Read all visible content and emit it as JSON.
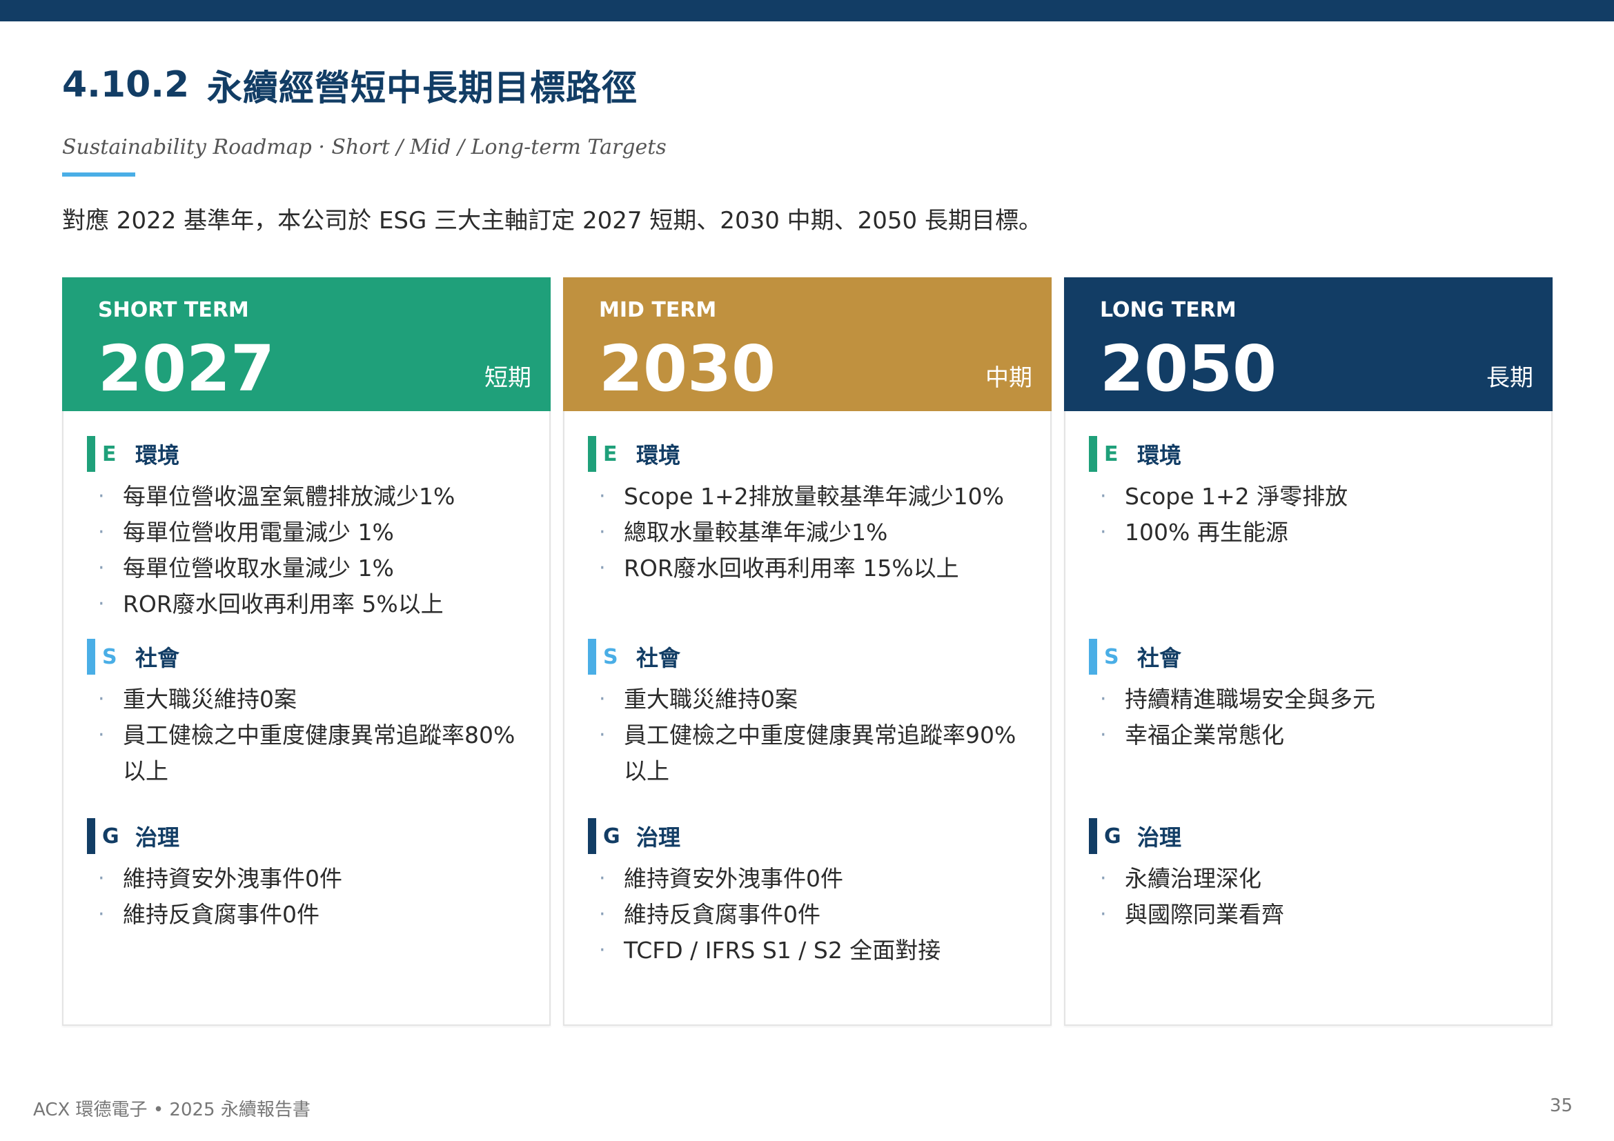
{
  "header": {
    "section_number": "4.10.2",
    "title": "永續經營短中長期目標路徑",
    "subtitle": "Sustainability Roadmap · Short / Mid / Long-term Targets",
    "intro": "對應 2022 基準年，本公司於 ESG 三大主軸訂定 2027 短期、2030 中期、2050 長期目標。"
  },
  "colors": {
    "navy": "#123d65",
    "short": "#1fa07a",
    "mid": "#c0913f",
    "long": "#123d65",
    "env_bar": "#1fa07a",
    "soc_bar": "#4aaee6",
    "gov_bar": "#123d65",
    "accent_underline": "#4aaee6"
  },
  "categories": {
    "e": {
      "letter": "E",
      "title": "環境"
    },
    "s": {
      "letter": "S",
      "title": "社會"
    },
    "g": {
      "letter": "G",
      "title": "治理"
    }
  },
  "cards": [
    {
      "term": "SHORT TERM",
      "year": "2027",
      "cn": "短期",
      "e": [
        "每單位營收溫室氣體排放減少1%",
        "每單位營收用電量減少 1%",
        "每單位營收取水量減少 1%",
        "ROR廢水回收再利用率 5%以上"
      ],
      "s": [
        "重大職災維持0案",
        "員工健檢之中重度健康異常追蹤率80%以上"
      ],
      "g": [
        "維持資安外洩事件0件",
        "維持反貪腐事件0件"
      ]
    },
    {
      "term": "MID TERM",
      "year": "2030",
      "cn": "中期",
      "e": [
        "Scope 1+2排放量較基準年減少10%",
        "總取水量較基準年減少1%",
        "ROR廢水回收再利用率 15%以上"
      ],
      "s": [
        "重大職災維持0案",
        "員工健檢之中重度健康異常追蹤率90%以上"
      ],
      "g": [
        "維持資安外洩事件0件",
        "維持反貪腐事件0件",
        "TCFD / IFRS S1 / S2 全面對接"
      ]
    },
    {
      "term": "LONG TERM",
      "year": "2050",
      "cn": "長期",
      "e": [
        "Scope 1+2 淨零排放",
        "100% 再生能源"
      ],
      "s": [
        "持續精進職場安全與多元",
        "幸福企業常態化"
      ],
      "g": [
        "永續治理深化",
        "與國際同業看齊"
      ]
    }
  ],
  "footer": {
    "left": "ACX 環德電子 • 2025 永續報告書",
    "page": "35"
  }
}
